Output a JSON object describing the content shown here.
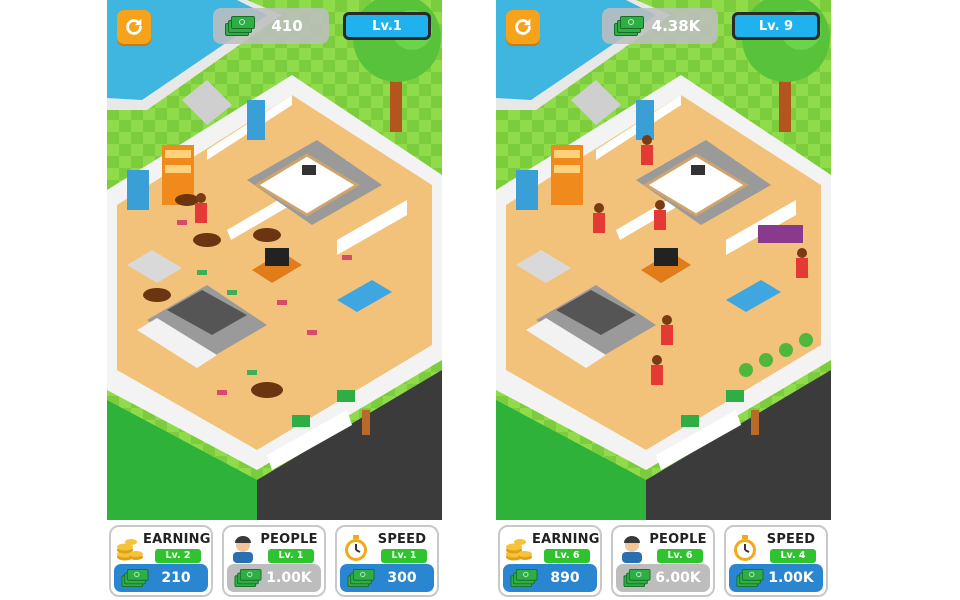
{
  "left": {
    "money": "410",
    "level": "Lv.1",
    "earning": {
      "title": "EARNING",
      "level": "Lv. 2",
      "cost": "210",
      "enabled": true
    },
    "people": {
      "title": "PEOPLE",
      "level": "Lv. 1",
      "cost": "1.00K",
      "enabled": false
    },
    "speed": {
      "title": "SPEED",
      "level": "Lv. 1",
      "cost": "300",
      "enabled": true
    }
  },
  "right": {
    "money": "4.38K",
    "level": "Lv. 9",
    "earning": {
      "title": "EARNING",
      "level": "Lv. 6",
      "cost": "890",
      "enabled": true
    },
    "people": {
      "title": "PEOPLE",
      "level": "Lv. 6",
      "cost": "6.00K",
      "enabled": true
    },
    "speed": {
      "title": "SPEED",
      "level": "Lv. 4",
      "cost": "1.00K",
      "enabled": true
    }
  },
  "colors": {
    "grass": "#7ccd3e",
    "floor": "#f2c27a",
    "wall": "#ffffff",
    "level_blue": "#1fb2ee",
    "button_blue": "#2b86d1",
    "badge_green": "#2fc32f",
    "refresh_orange": "#f7a21b"
  }
}
